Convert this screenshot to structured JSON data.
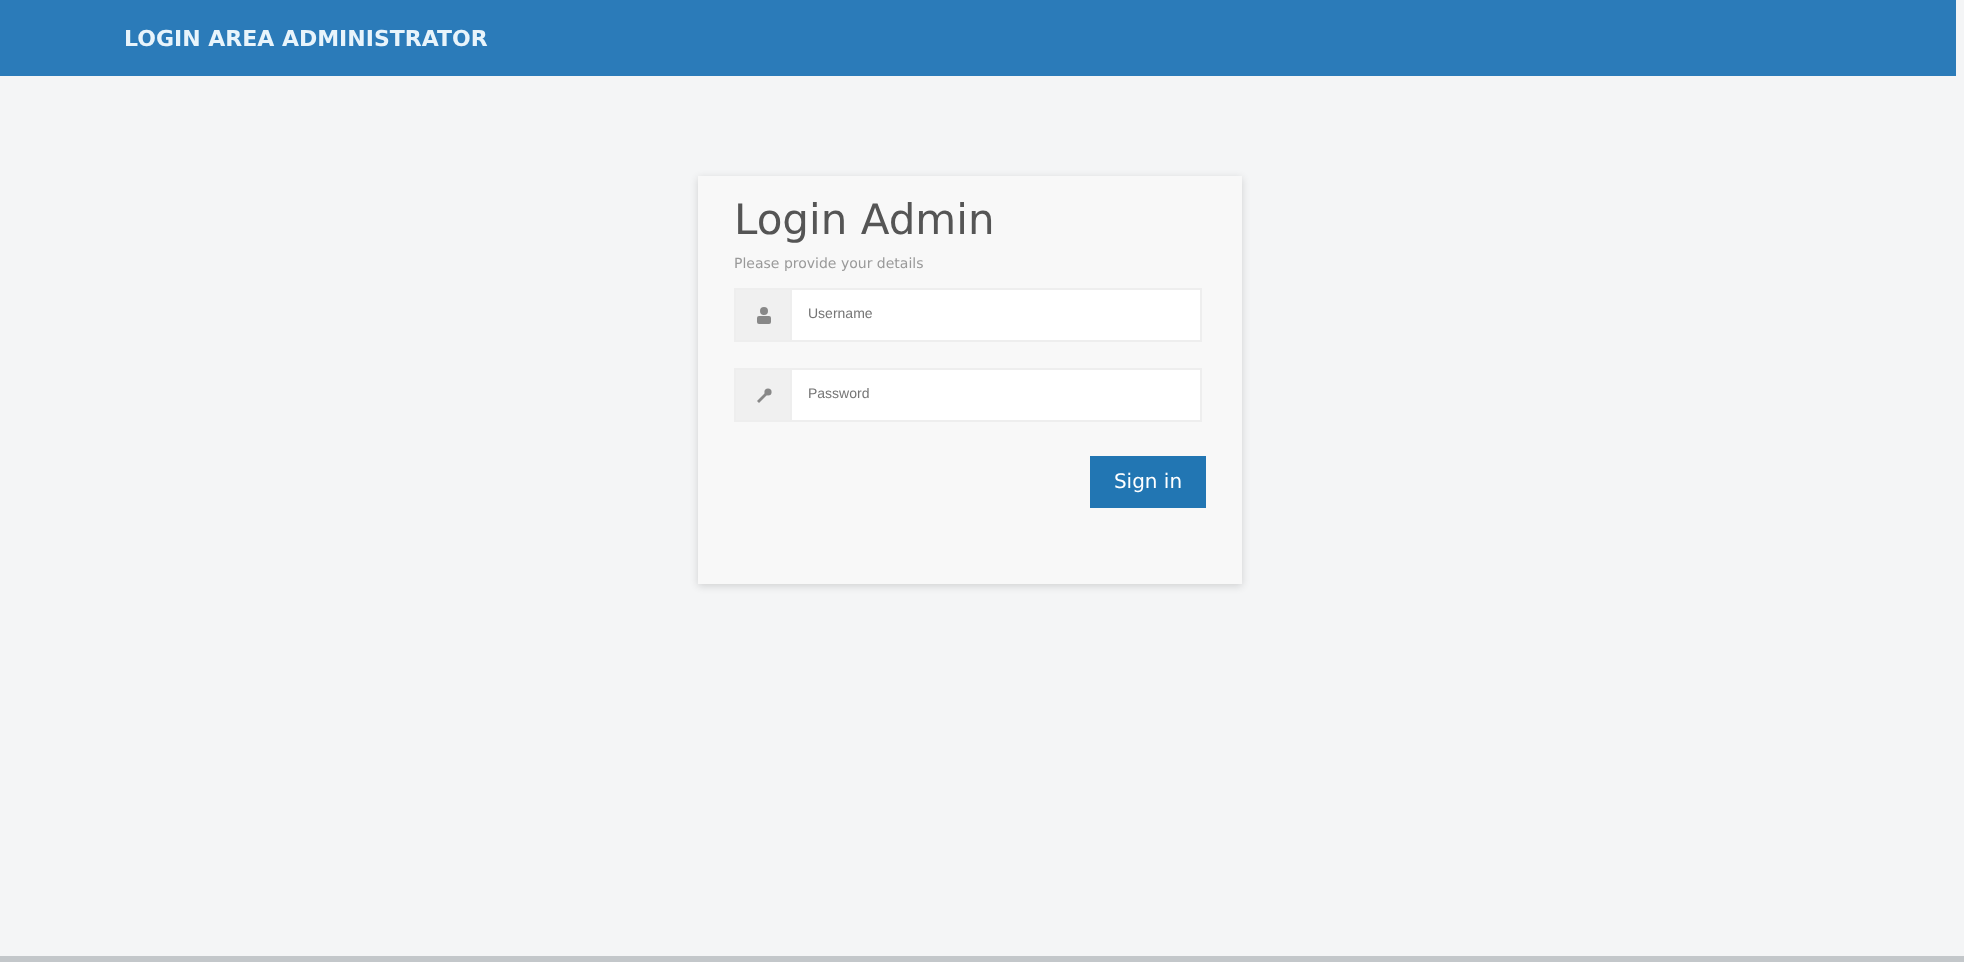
{
  "header": {
    "title": "LOGIN AREA ADMINISTRATOR"
  },
  "login": {
    "title": "Login Admin",
    "subtitle": "Please provide your details",
    "fields": [
      {
        "kind": "user",
        "placeholder": "Username"
      },
      {
        "kind": "password",
        "placeholder": "Password"
      }
    ],
    "button": "Sign in"
  }
}
